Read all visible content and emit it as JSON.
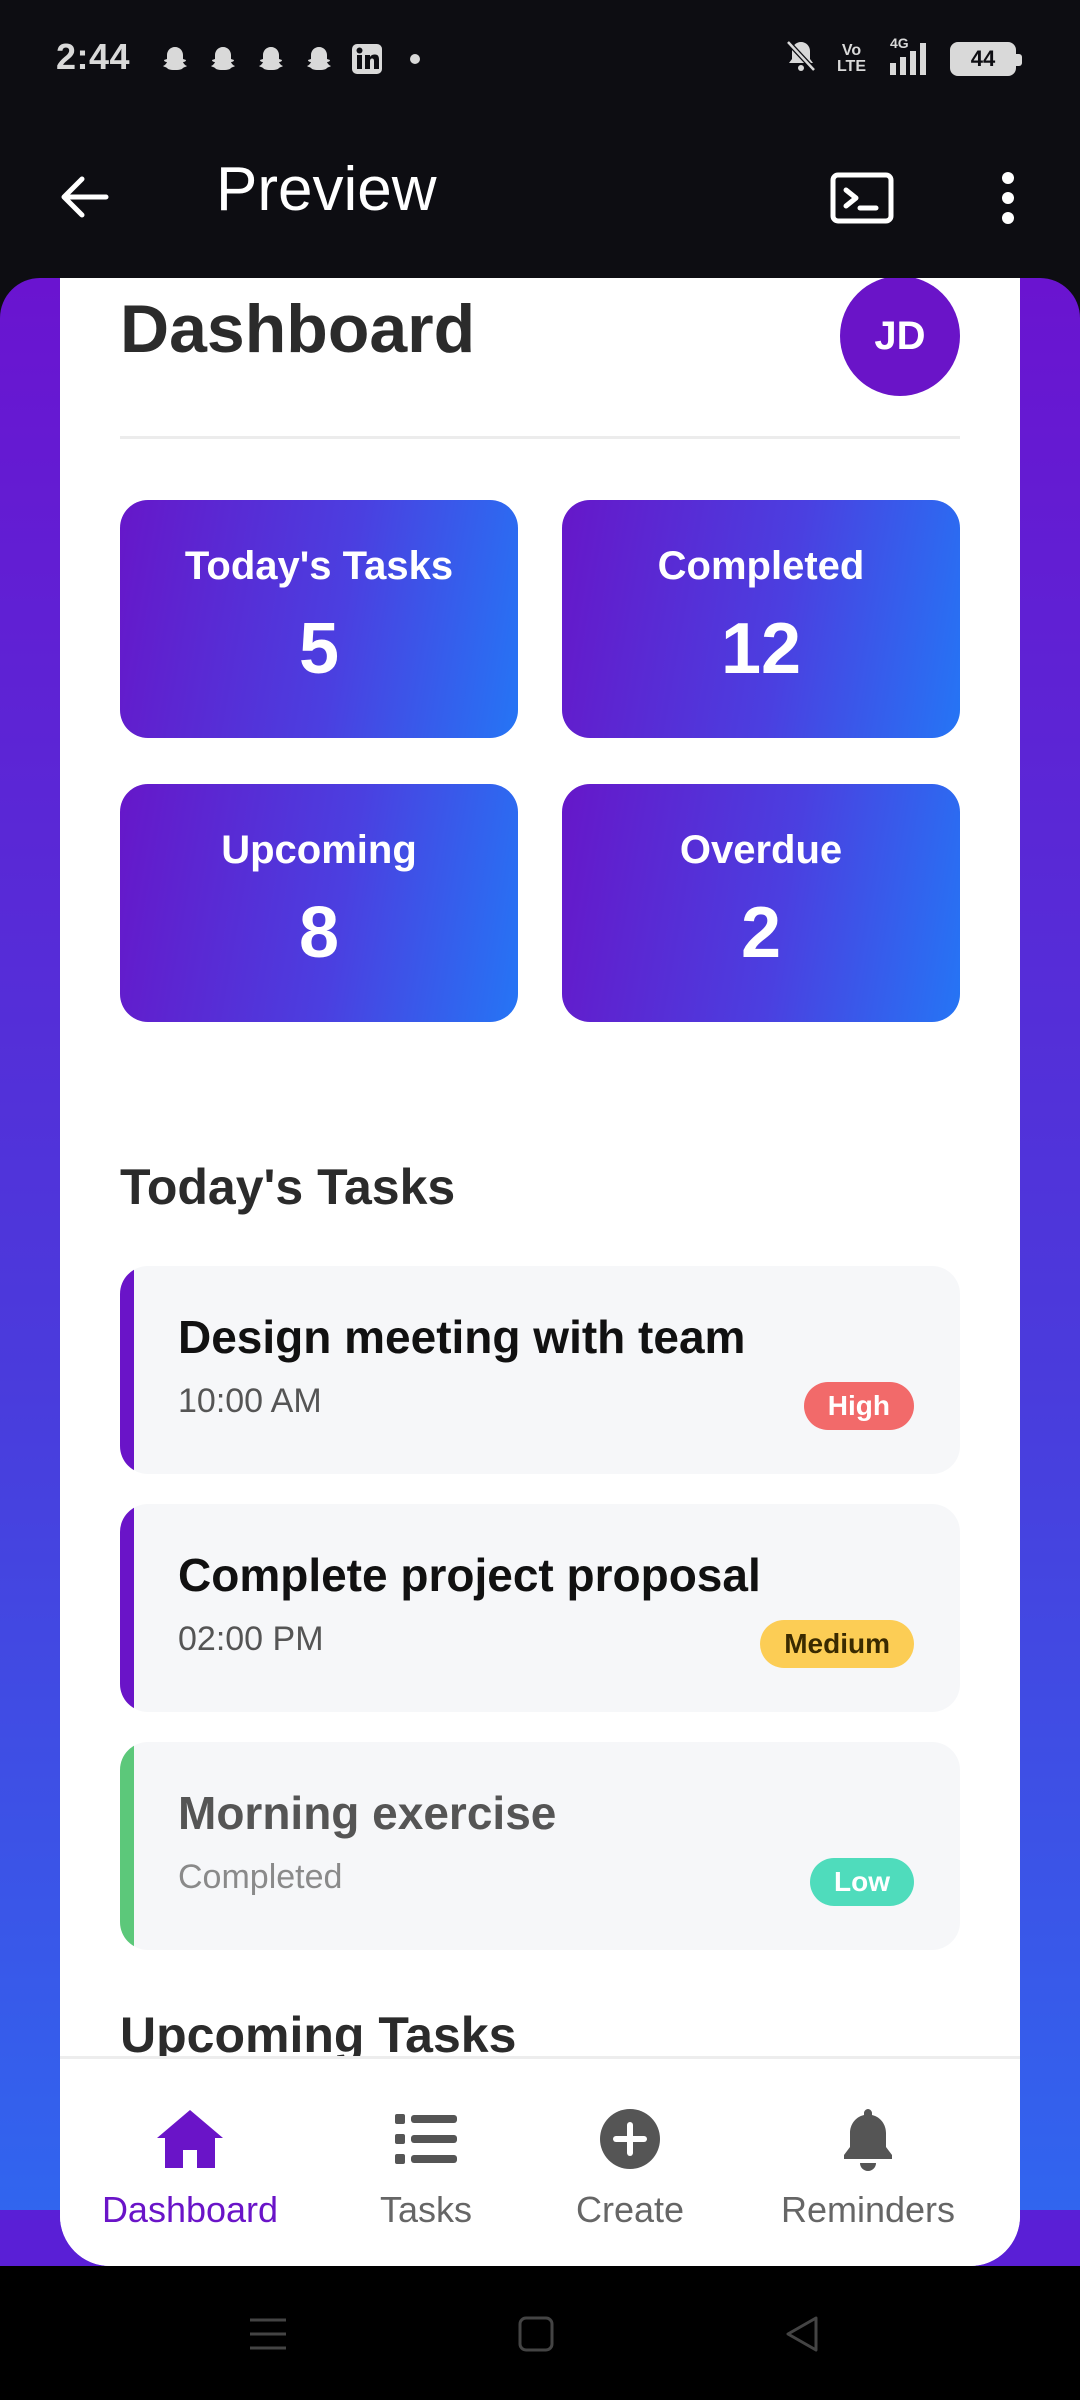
{
  "status_bar": {
    "time": "2:44",
    "left_icons": [
      "snapchat-icon",
      "snapchat-icon",
      "snapchat-icon",
      "snapchat-icon",
      "linkedin-icon",
      "dot-icon"
    ],
    "volte_line1": "Vo",
    "volte_line2": "LTE",
    "network": "4G",
    "battery": "44"
  },
  "app_bar": {
    "title": "Preview"
  },
  "dashboard": {
    "title": "Dashboard",
    "avatar_initials": "JD",
    "stats": [
      {
        "label": "Today's Tasks",
        "value": "5"
      },
      {
        "label": "Completed",
        "value": "12"
      },
      {
        "label": "Upcoming",
        "value": "8"
      },
      {
        "label": "Overdue",
        "value": "2"
      }
    ]
  },
  "todays_tasks": {
    "title": "Today's Tasks",
    "items": [
      {
        "title": "Design meeting with team",
        "subtitle": "10:00 AM",
        "priority": "High",
        "bar_color": "#6a14c8",
        "badge_bg": "#f26a6a",
        "badge_fg": "#ffffff"
      },
      {
        "title": "Complete project proposal",
        "subtitle": "02:00 PM",
        "priority": "Medium",
        "bar_color": "#6a14c8",
        "badge_bg": "#fccd55",
        "badge_fg": "#3a2a00"
      },
      {
        "title": "Morning exercise",
        "subtitle": "Completed",
        "priority": "Low",
        "bar_color": "#5cc87a",
        "badge_bg": "#4fdcbc",
        "badge_fg": "#ffffff"
      }
    ]
  },
  "upcoming": {
    "title": "Upcoming Tasks"
  },
  "bottom_nav": {
    "items": [
      {
        "label": "Dashboard",
        "icon": "home-icon",
        "active": true
      },
      {
        "label": "Tasks",
        "icon": "list-icon",
        "active": false
      },
      {
        "label": "Create",
        "icon": "plus-circle-icon",
        "active": false
      },
      {
        "label": "Reminders",
        "icon": "bell-icon",
        "active": false
      }
    ]
  },
  "colors": {
    "accent": "#6a14c8",
    "gradient_start": "#6617c9",
    "gradient_end": "#2575f5"
  }
}
